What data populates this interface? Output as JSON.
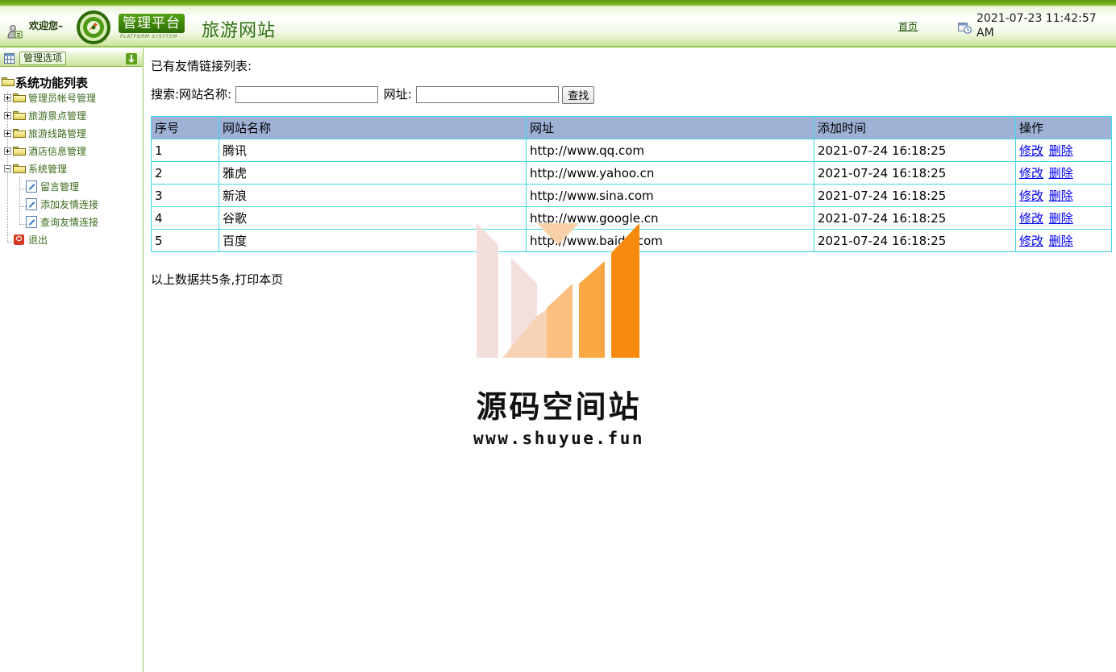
{
  "header": {
    "welcome": "欢迎您–",
    "platform_label": "管理平台",
    "platform_sub": "PLATFORM SYSYTEM",
    "site_title": "旅游网站",
    "home_link": "首页",
    "datetime": "2021-07-23 11:42:57 AM",
    "accent_color": "#6aa81a"
  },
  "sidebar": {
    "title": "管理选项",
    "root": "系统功能列表",
    "groups": [
      {
        "label": "管理员帐号管理",
        "expanded": false
      },
      {
        "label": "旅游景点管理",
        "expanded": false
      },
      {
        "label": "旅游线路管理",
        "expanded": false
      },
      {
        "label": "酒店信息管理",
        "expanded": false
      },
      {
        "label": "系统管理",
        "expanded": true
      }
    ],
    "sub_items": [
      "留言管理",
      "添加友情连接",
      "查询友情连接"
    ],
    "exit": "退出"
  },
  "main": {
    "heading": "已有友情链接列表:",
    "search": {
      "prefix": "搜索:网站名称:",
      "name_value": "",
      "url_label": "网址:",
      "url_value": "",
      "button": "查找"
    },
    "table": {
      "headers": [
        "序号",
        "网站名称",
        "网址",
        "添加时间",
        "操作"
      ],
      "rows": [
        {
          "id": "1",
          "name": "腾讯",
          "url": "http://www.qq.com",
          "time": "2021-07-24 16:18:25"
        },
        {
          "id": "2",
          "name": "雅虎",
          "url": "http://www.yahoo.cn",
          "time": "2021-07-24 16:18:25"
        },
        {
          "id": "3",
          "name": "新浪",
          "url": "http://www.sina.com",
          "time": "2021-07-24 16:18:25"
        },
        {
          "id": "4",
          "name": "谷歌",
          "url": "http://www.google.cn",
          "time": "2021-07-24 16:18:25"
        },
        {
          "id": "5",
          "name": "百度",
          "url": "http://www.baidu.com",
          "time": "2021-07-24 16:18:25"
        }
      ],
      "edit_label": "修改",
      "delete_label": "删除"
    },
    "footer": "以上数据共5条,打印本页"
  },
  "watermark": {
    "text": "源码空间站",
    "url": "www.shuyue.fun"
  }
}
